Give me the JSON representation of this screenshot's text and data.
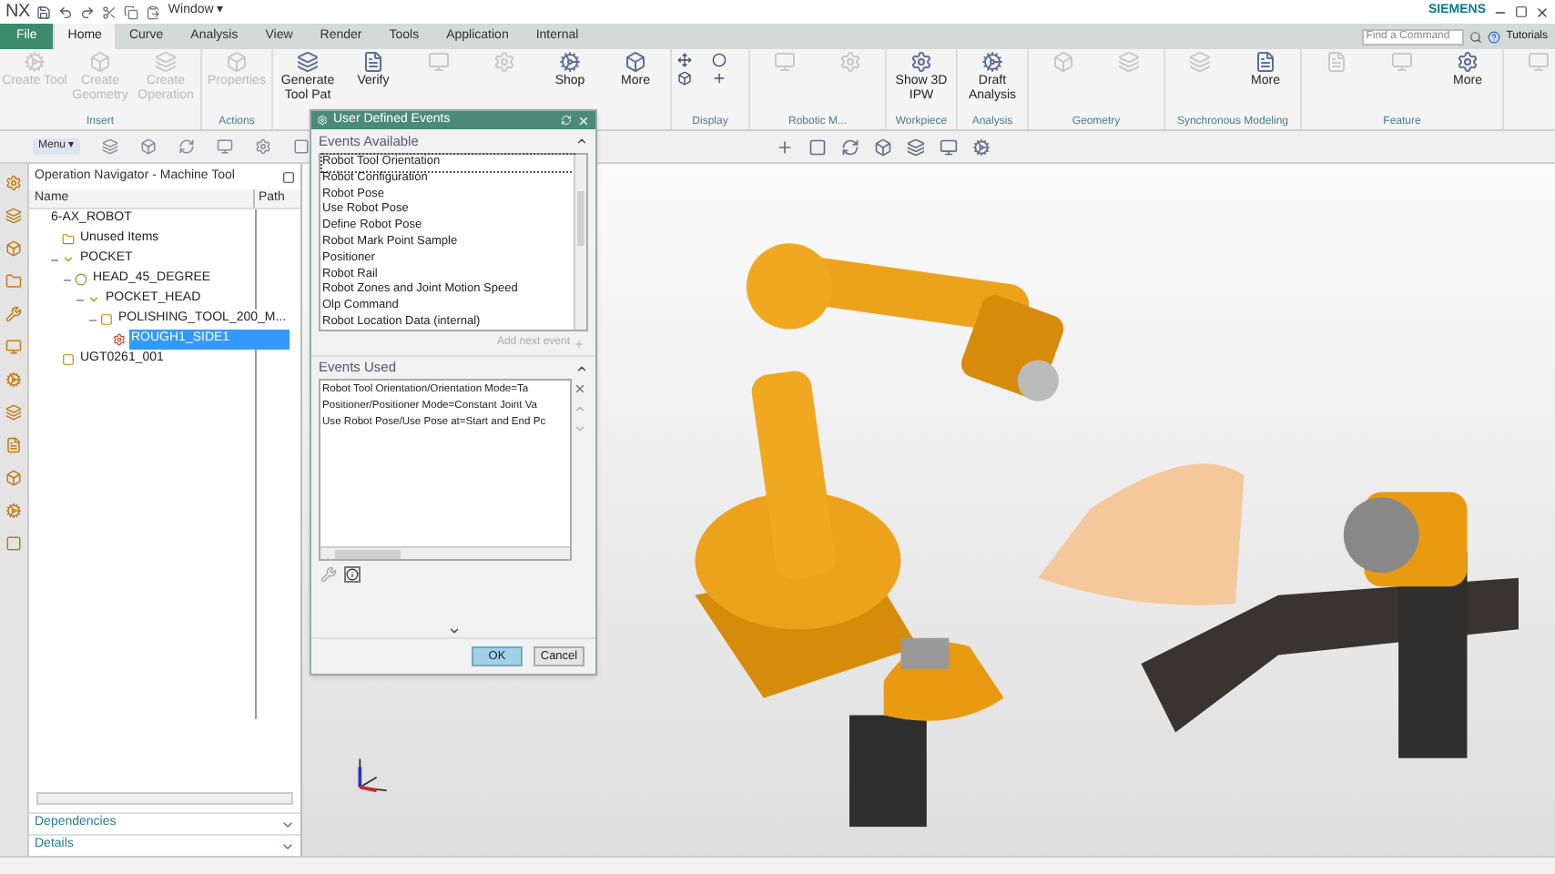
{
  "title_bar": {
    "app": "NX",
    "window_menu": "Window ▾",
    "brand": "SIEMENS"
  },
  "menu_tabs": [
    {
      "label": "File",
      "kind": "file",
      "selected": false
    },
    {
      "label": "Home",
      "kind": "tab",
      "selected": true
    },
    {
      "label": "Curve",
      "kind": "tab",
      "selected": false
    },
    {
      "label": "Analysis",
      "kind": "tab",
      "selected": false
    },
    {
      "label": "View",
      "kind": "tab",
      "selected": false
    },
    {
      "label": "Render",
      "kind": "tab",
      "selected": false
    },
    {
      "label": "Tools",
      "kind": "tab",
      "selected": false
    },
    {
      "label": "Application",
      "kind": "tab",
      "selected": false
    },
    {
      "label": "Internal",
      "kind": "tab",
      "selected": false
    }
  ],
  "search": {
    "placeholder": "Find a Command"
  },
  "tutorials": "Tutorials",
  "ribbon": [
    {
      "label": "Insert",
      "buttons": [
        {
          "label": "Create Tool",
          "disabled": true
        },
        {
          "label": "Create Geometry",
          "disabled": true
        },
        {
          "label": "Create Operation",
          "disabled": true
        }
      ]
    },
    {
      "label": "Actions",
      "buttons": [
        {
          "label": "Properties",
          "disabled": true
        }
      ]
    },
    {
      "buttons": [
        {
          "label": "Generate Tool Pat",
          "disabled": false
        },
        {
          "label": "Verify",
          "disabled": false
        },
        {
          "disabled": true
        },
        {
          "disabled": true
        },
        {
          "label": "Shop",
          "disabled": false
        },
        {
          "label": "More",
          "disabled": false
        }
      ]
    },
    {
      "label": "Display"
    },
    {
      "label": "Robotic M...",
      "buttons": [
        {
          "disabled": true
        },
        {
          "disabled": true
        }
      ]
    },
    {
      "label": "Workpiece",
      "buttons": [
        {
          "label": "Show 3D IPW",
          "disabled": false
        }
      ]
    },
    {
      "label": "Analysis",
      "buttons": [
        {
          "label": "Draft Analysis",
          "disabled": false
        }
      ]
    },
    {
      "label": "Geometry",
      "buttons": [
        {
          "disabled": true
        },
        {
          "disabled": true
        }
      ]
    },
    {
      "label": "Synchronous Modeling",
      "buttons": [
        {
          "disabled": true
        },
        {
          "label": "More",
          "disabled": false
        }
      ]
    },
    {
      "label": "Feature",
      "buttons": [
        {
          "disabled": true
        },
        {
          "disabled": true
        },
        {
          "label": "More",
          "disabled": false
        }
      ]
    },
    {
      "buttons": [
        {
          "disabled": true
        }
      ]
    }
  ],
  "toolbar": {
    "menu": "Menu ▾"
  },
  "navigator": {
    "title": "Operation Navigator - Machine Tool",
    "columns": [
      "Name",
      "Path"
    ],
    "tree": [
      {
        "label": "6-AX_ROBOT",
        "selected": false,
        "children": [
          {
            "label": "Unused Items",
            "kind": "folder",
            "selected": false
          },
          {
            "label": "POCKET",
            "kind": "pocket",
            "selected": false,
            "children": [
              {
                "label": "HEAD_45_DEGREE",
                "kind": "head",
                "selected": false,
                "children": [
                  {
                    "label": "POCKET_HEAD",
                    "kind": "pocket",
                    "selected": false,
                    "children": [
                      {
                        "label": "POLISHING_TOOL_200_M...",
                        "kind": "tool",
                        "selected": false,
                        "children": [
                          {
                            "label": "ROUGH1_SIDE1",
                            "kind": "operation",
                            "selected": true
                          }
                        ]
                      }
                    ]
                  }
                ]
              }
            ]
          },
          {
            "label": "UGT0261_001",
            "kind": "tool",
            "selected": false
          }
        ]
      }
    ]
  },
  "panels": [
    {
      "label": "Dependencies",
      "expanded": false
    },
    {
      "label": "Details",
      "expanded": false
    }
  ],
  "dialog": {
    "title": "User Defined Events",
    "events_available": {
      "heading": "Events Available",
      "expanded": true,
      "add_button": "Add next event",
      "items": [
        {
          "label": "Robot Tool Orientation",
          "selected": true
        },
        {
          "label": "Robot Configuration",
          "selected": false
        },
        {
          "label": "Robot Pose",
          "selected": false
        },
        {
          "label": "Use Robot Pose",
          "selected": false
        },
        {
          "label": "Define Robot Pose",
          "selected": false
        },
        {
          "label": "Robot Mark Point Sample",
          "selected": false
        },
        {
          "label": "Positioner",
          "selected": false
        },
        {
          "label": "Robot Rail",
          "selected": false
        },
        {
          "label": "Robot Zones and Joint Motion Speed",
          "selected": false
        },
        {
          "label": "Olp Command",
          "selected": false
        },
        {
          "label": "Robot Location Data (internal)",
          "selected": false
        }
      ]
    },
    "events_used": {
      "heading": "Events Used",
      "expanded": true,
      "items": [
        "Robot Tool Orientation/Orientation Mode=Ta",
        "Positioner/Positioner Mode=Constant Joint Va",
        "Use Robot Pose/Use Pose at=Start and End Pc"
      ]
    },
    "ok": "OK",
    "cancel": "Cancel"
  }
}
